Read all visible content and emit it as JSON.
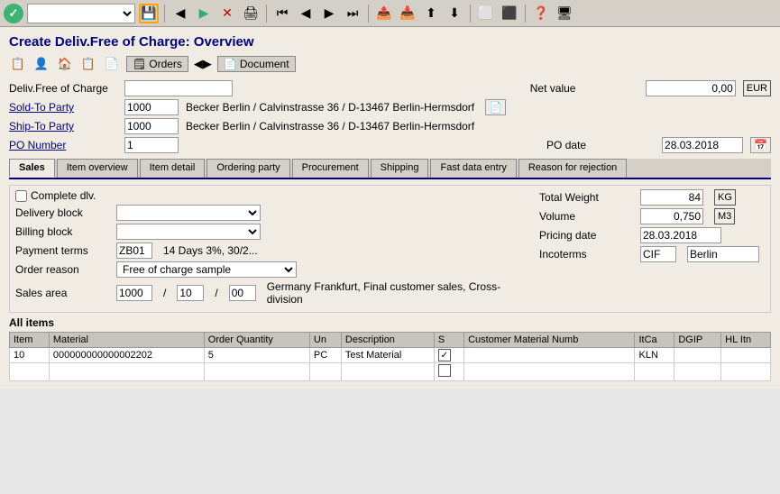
{
  "toolbar": {
    "check_icon": "✓",
    "save_label": "💾",
    "dropdown_placeholder": "",
    "nav_icons": [
      "◀",
      "▶",
      "✕",
      "🖨",
      "↕",
      "↕",
      "↑",
      "⬆",
      "↓",
      "⬇",
      "⬜",
      "⬜",
      "⬜",
      "⬜",
      "?",
      "🖥"
    ]
  },
  "page": {
    "title": "Create Deliv.Free of Charge: Overview"
  },
  "second_toolbar": {
    "icons": [
      "📋",
      "👤",
      "🏠",
      "📄",
      "📋"
    ],
    "orders_label": "Orders",
    "document_label": "Document"
  },
  "form": {
    "deliv_free_label": "Deliv.Free of Charge",
    "net_value_label": "Net value",
    "net_value": "0,00",
    "net_value_currency": "EUR",
    "sold_to_label": "Sold-To Party",
    "sold_to_id": "1000",
    "sold_to_address": "Becker Berlin / Calvinstrasse 36 / D-13467 Berlin-Hermsdorf",
    "ship_to_label": "Ship-To Party",
    "ship_to_id": "1000",
    "ship_to_address": "Becker Berlin / Calvinstrasse 36 / D-13467 Berlin-Hermsdorf",
    "po_number_label": "PO Number",
    "po_number": "1",
    "po_date_label": "PO date",
    "po_date": "28.03.2018"
  },
  "tabs": [
    {
      "id": "sales",
      "label": "Sales",
      "active": true
    },
    {
      "id": "item-overview",
      "label": "Item overview",
      "active": false
    },
    {
      "id": "item-detail",
      "label": "Item detail",
      "active": false
    },
    {
      "id": "ordering-party",
      "label": "Ordering party",
      "active": false
    },
    {
      "id": "procurement",
      "label": "Procurement",
      "active": false
    },
    {
      "id": "shipping",
      "label": "Shipping",
      "active": false
    },
    {
      "id": "fast-data",
      "label": "Fast data entry",
      "active": false
    },
    {
      "id": "reason-rejection",
      "label": "Reason for rejection",
      "active": false
    }
  ],
  "sales_tab": {
    "complete_dlv_label": "Complete dlv.",
    "total_weight_label": "Total Weight",
    "total_weight_value": "84",
    "total_weight_unit": "KG",
    "delivery_block_label": "Delivery block",
    "volume_label": "Volume",
    "volume_value": "0,750",
    "volume_unit": "M3",
    "billing_block_label": "Billing block",
    "pricing_date_label": "Pricing date",
    "pricing_date_value": "28.03.2018",
    "payment_terms_label": "Payment terms",
    "payment_terms_code": "ZB01",
    "payment_terms_desc": "14 Days 3%, 30/2...",
    "incoterms_label": "Incoterms",
    "incoterms_code": "CIF",
    "incoterms_place": "Berlin",
    "order_reason_label": "Order reason",
    "order_reason_value": "Free of charge sample",
    "sales_area_label": "Sales area",
    "sales_area_value": "1000 / 10 / 00",
    "sales_area_desc": "Germany Frankfurt, Final customer sales, Cross-division"
  },
  "all_items": {
    "label": "All items",
    "columns": [
      "Item",
      "Material",
      "Order Quantity",
      "Un",
      "Description",
      "S",
      "Customer Material Numb",
      "ItCa",
      "DGIP",
      "HL Itn"
    ],
    "rows": [
      {
        "item": "10",
        "material": "000000000000002202",
        "order_quantity": "5",
        "un": "PC",
        "description": "Test Material",
        "s": "checked",
        "customer_material": "",
        "itca": "KLN",
        "dgip": "",
        "hl_itn": ""
      },
      {
        "item": "",
        "material": "",
        "order_quantity": "",
        "un": "",
        "description": "",
        "s": "unchecked",
        "customer_material": "",
        "itca": "",
        "dgip": "",
        "hl_itn": ""
      }
    ]
  }
}
